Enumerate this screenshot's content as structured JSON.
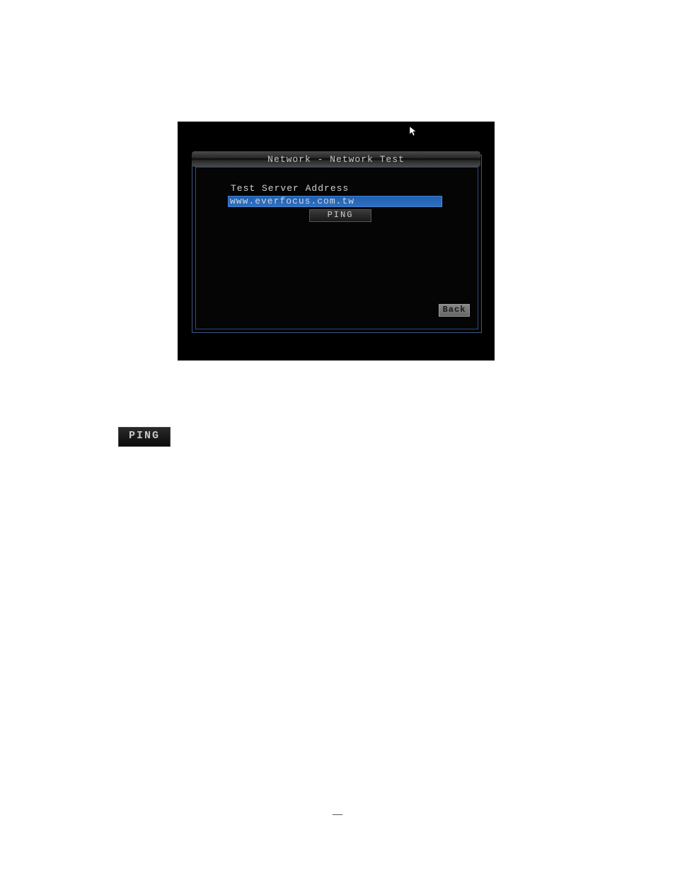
{
  "dialog": {
    "title": "Network - Network Test",
    "field_label": "Test Server Address",
    "address_value": "www.everfocus.com.tw",
    "ping_label": "PING",
    "back_label": "Back"
  },
  "badge": {
    "ping_label": "PING"
  }
}
